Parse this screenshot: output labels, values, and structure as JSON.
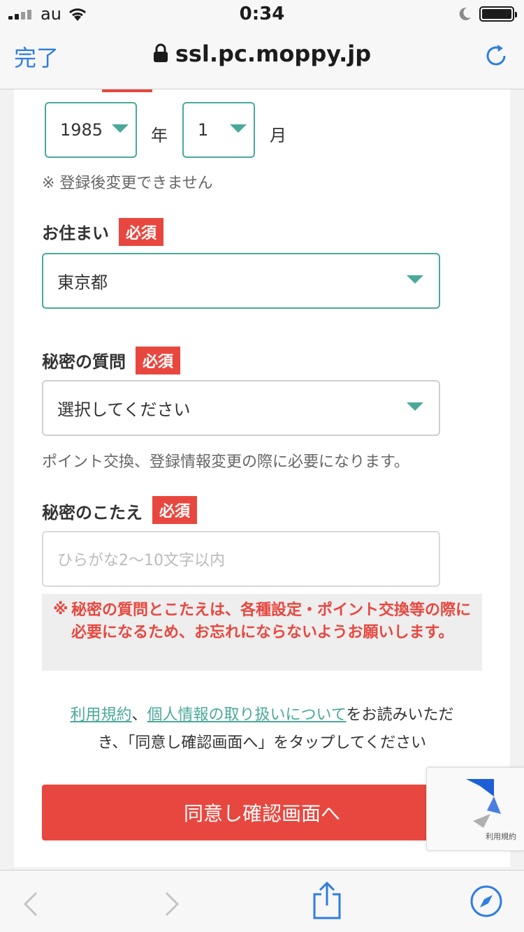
{
  "status": {
    "carrier": "au",
    "time": "0:34"
  },
  "nav": {
    "done": "完了",
    "url": "ssl.pc.moppy.jp"
  },
  "birth": {
    "year": "1985",
    "year_unit": "年",
    "month": "1",
    "month_unit": "月",
    "note": "※ 登録後変更できません"
  },
  "residence": {
    "label": "お住まい",
    "badge": "必須",
    "value": "東京都"
  },
  "secret_q": {
    "label": "秘密の質問",
    "badge": "必須",
    "value": "選択してください",
    "note": "ポイント交換、登録情報変更の際に必要になります。"
  },
  "secret_a": {
    "label": "秘密のこたえ",
    "badge": "必須",
    "placeholder": "ひらがな2～10文字以内"
  },
  "warning": {
    "mark": "※",
    "text": "秘密の質問とこたえは、各種設定・ポイント交換等の際に必要になるため、お忘れにならないようお願いします。"
  },
  "agree": {
    "link_terms": "利用規約",
    "sep": "、",
    "link_privacy": "個人情報の取り扱いについて",
    "text_line1_rest": "をお読みいただ",
    "text_line2": "き、「同意し確認画面へ」をタップしてください"
  },
  "submit": "同意し確認画面へ",
  "recaptcha": {
    "terms": "利用規約"
  }
}
